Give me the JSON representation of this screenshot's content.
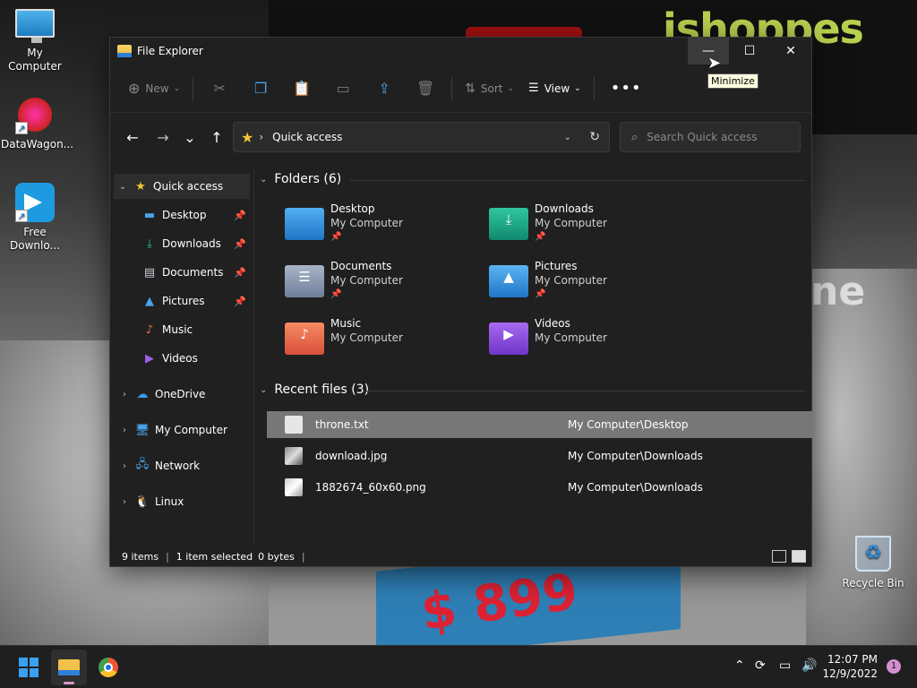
{
  "desktop": {
    "icons": [
      {
        "label": "My Computer",
        "icon": "monitor-icon"
      },
      {
        "label": "DataWagon...",
        "icon": "datawagon-icon"
      },
      {
        "label": "Free Downlo...",
        "icon": "free-download-manager-icon"
      },
      {
        "label": "Recycle Bin",
        "icon": "recycle-bin-icon"
      }
    ],
    "wallpaper_text": {
      "brand": "ishoppes",
      "price": "$ 899",
      "suffix": "ne"
    }
  },
  "window": {
    "title": "File Explorer",
    "tooltip": "Minimize",
    "controls": {
      "minimize": "—",
      "maximize": "☐",
      "close": "✕"
    }
  },
  "toolbar": {
    "new_label": "New",
    "sort_label": "Sort",
    "view_label": "View",
    "more_label": "•••",
    "icons": [
      "cut-icon",
      "copy-icon",
      "paste-icon",
      "rename-icon",
      "share-icon",
      "delete-icon"
    ]
  },
  "navigation": {
    "back": "←",
    "forward": "→",
    "recent": "⌄",
    "up": "↑",
    "address_crumb": "Quick access",
    "search_placeholder": "Search Quick access"
  },
  "sidebar": {
    "items": [
      {
        "label": "Quick access",
        "icon": "star-icon",
        "expanded": true,
        "selected": true
      },
      {
        "label": "Desktop",
        "icon": "desktop-icon",
        "pinned": true
      },
      {
        "label": "Downloads",
        "icon": "download-icon",
        "pinned": true
      },
      {
        "label": "Documents",
        "icon": "document-icon",
        "pinned": true
      },
      {
        "label": "Pictures",
        "icon": "picture-icon",
        "pinned": true
      },
      {
        "label": "Music",
        "icon": "music-icon"
      },
      {
        "label": "Videos",
        "icon": "video-icon"
      },
      {
        "label": "OneDrive",
        "icon": "cloud-icon"
      },
      {
        "label": "My Computer",
        "icon": "computer-icon"
      },
      {
        "label": "Network",
        "icon": "network-icon"
      },
      {
        "label": "Linux",
        "icon": "linux-icon"
      }
    ]
  },
  "content": {
    "folders_header": "Folders (6)",
    "folders": [
      {
        "name": "Desktop",
        "location": "My Computer",
        "pinned": true,
        "color": "#2f8fe0"
      },
      {
        "name": "Downloads",
        "location": "My Computer",
        "pinned": true,
        "color": "#1aa58a"
      },
      {
        "name": "Documents",
        "location": "My Computer",
        "pinned": true,
        "color": "#8c9bb3"
      },
      {
        "name": "Pictures",
        "location": "My Computer",
        "pinned": true,
        "color": "#2f8fe0"
      },
      {
        "name": "Music",
        "location": "My Computer",
        "pinned": false,
        "color": "#ea6a4a"
      },
      {
        "name": "Videos",
        "location": "My Computer",
        "pinned": false,
        "color": "#8a4fd8"
      }
    ],
    "recent_header": "Recent files (3)",
    "recent": [
      {
        "name": "throne.txt",
        "location": "My Computer\\Desktop",
        "selected": true
      },
      {
        "name": "download.jpg",
        "location": "My Computer\\Downloads",
        "selected": false
      },
      {
        "name": "1882674_60x60.png",
        "location": "My Computer\\Downloads",
        "selected": false
      }
    ]
  },
  "statusbar": {
    "items": "9 items",
    "selected": "1 item selected",
    "size": "0 bytes"
  },
  "taskbar": {
    "time": "12:07 PM",
    "date": "12/9/2022",
    "notifications": "1",
    "apps": [
      "start-icon",
      "file-explorer-icon",
      "chrome-icon"
    ]
  }
}
